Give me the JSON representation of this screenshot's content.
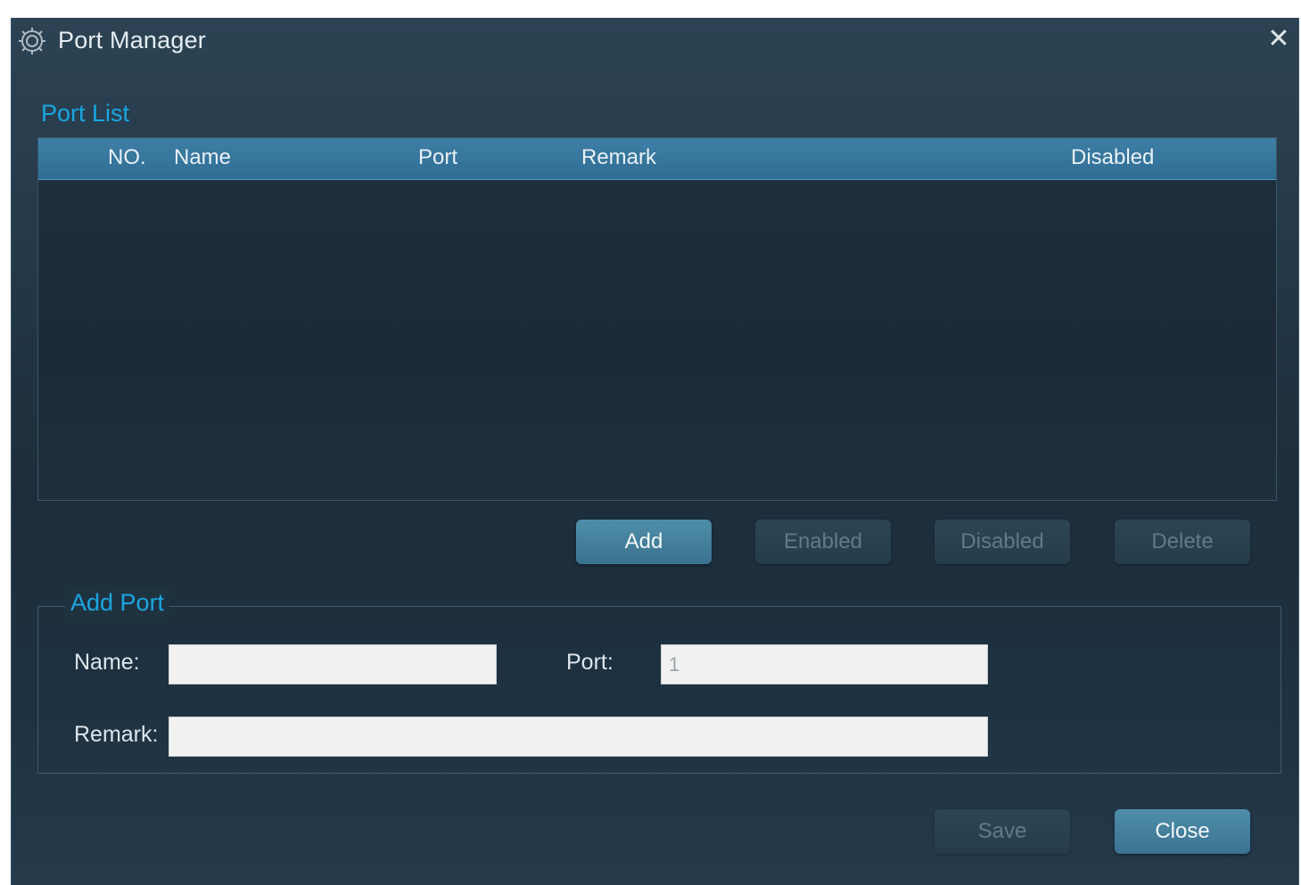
{
  "window": {
    "title": "Port Manager",
    "close_symbol": "✕"
  },
  "port_list": {
    "section_title": "Port List",
    "columns": [
      "NO.",
      "Name",
      "Port",
      "Remark",
      "Disabled"
    ],
    "rows": []
  },
  "actions": {
    "add": "Add",
    "enabled": "Enabled",
    "disabled": "Disabled",
    "delete": "Delete"
  },
  "add_port": {
    "section_title": "Add Port",
    "name_label": "Name:",
    "port_label": "Port:",
    "remark_label": "Remark:",
    "name_value": "",
    "port_value": "1",
    "remark_value": ""
  },
  "footer": {
    "save": "Save",
    "close": "Close"
  },
  "colors": {
    "accent": "#1aa6e0",
    "header_bg": "#3a78a0",
    "primary_button": "#4a89a6"
  },
  "icons": {
    "app": "gear-icon",
    "close": "close-icon"
  }
}
